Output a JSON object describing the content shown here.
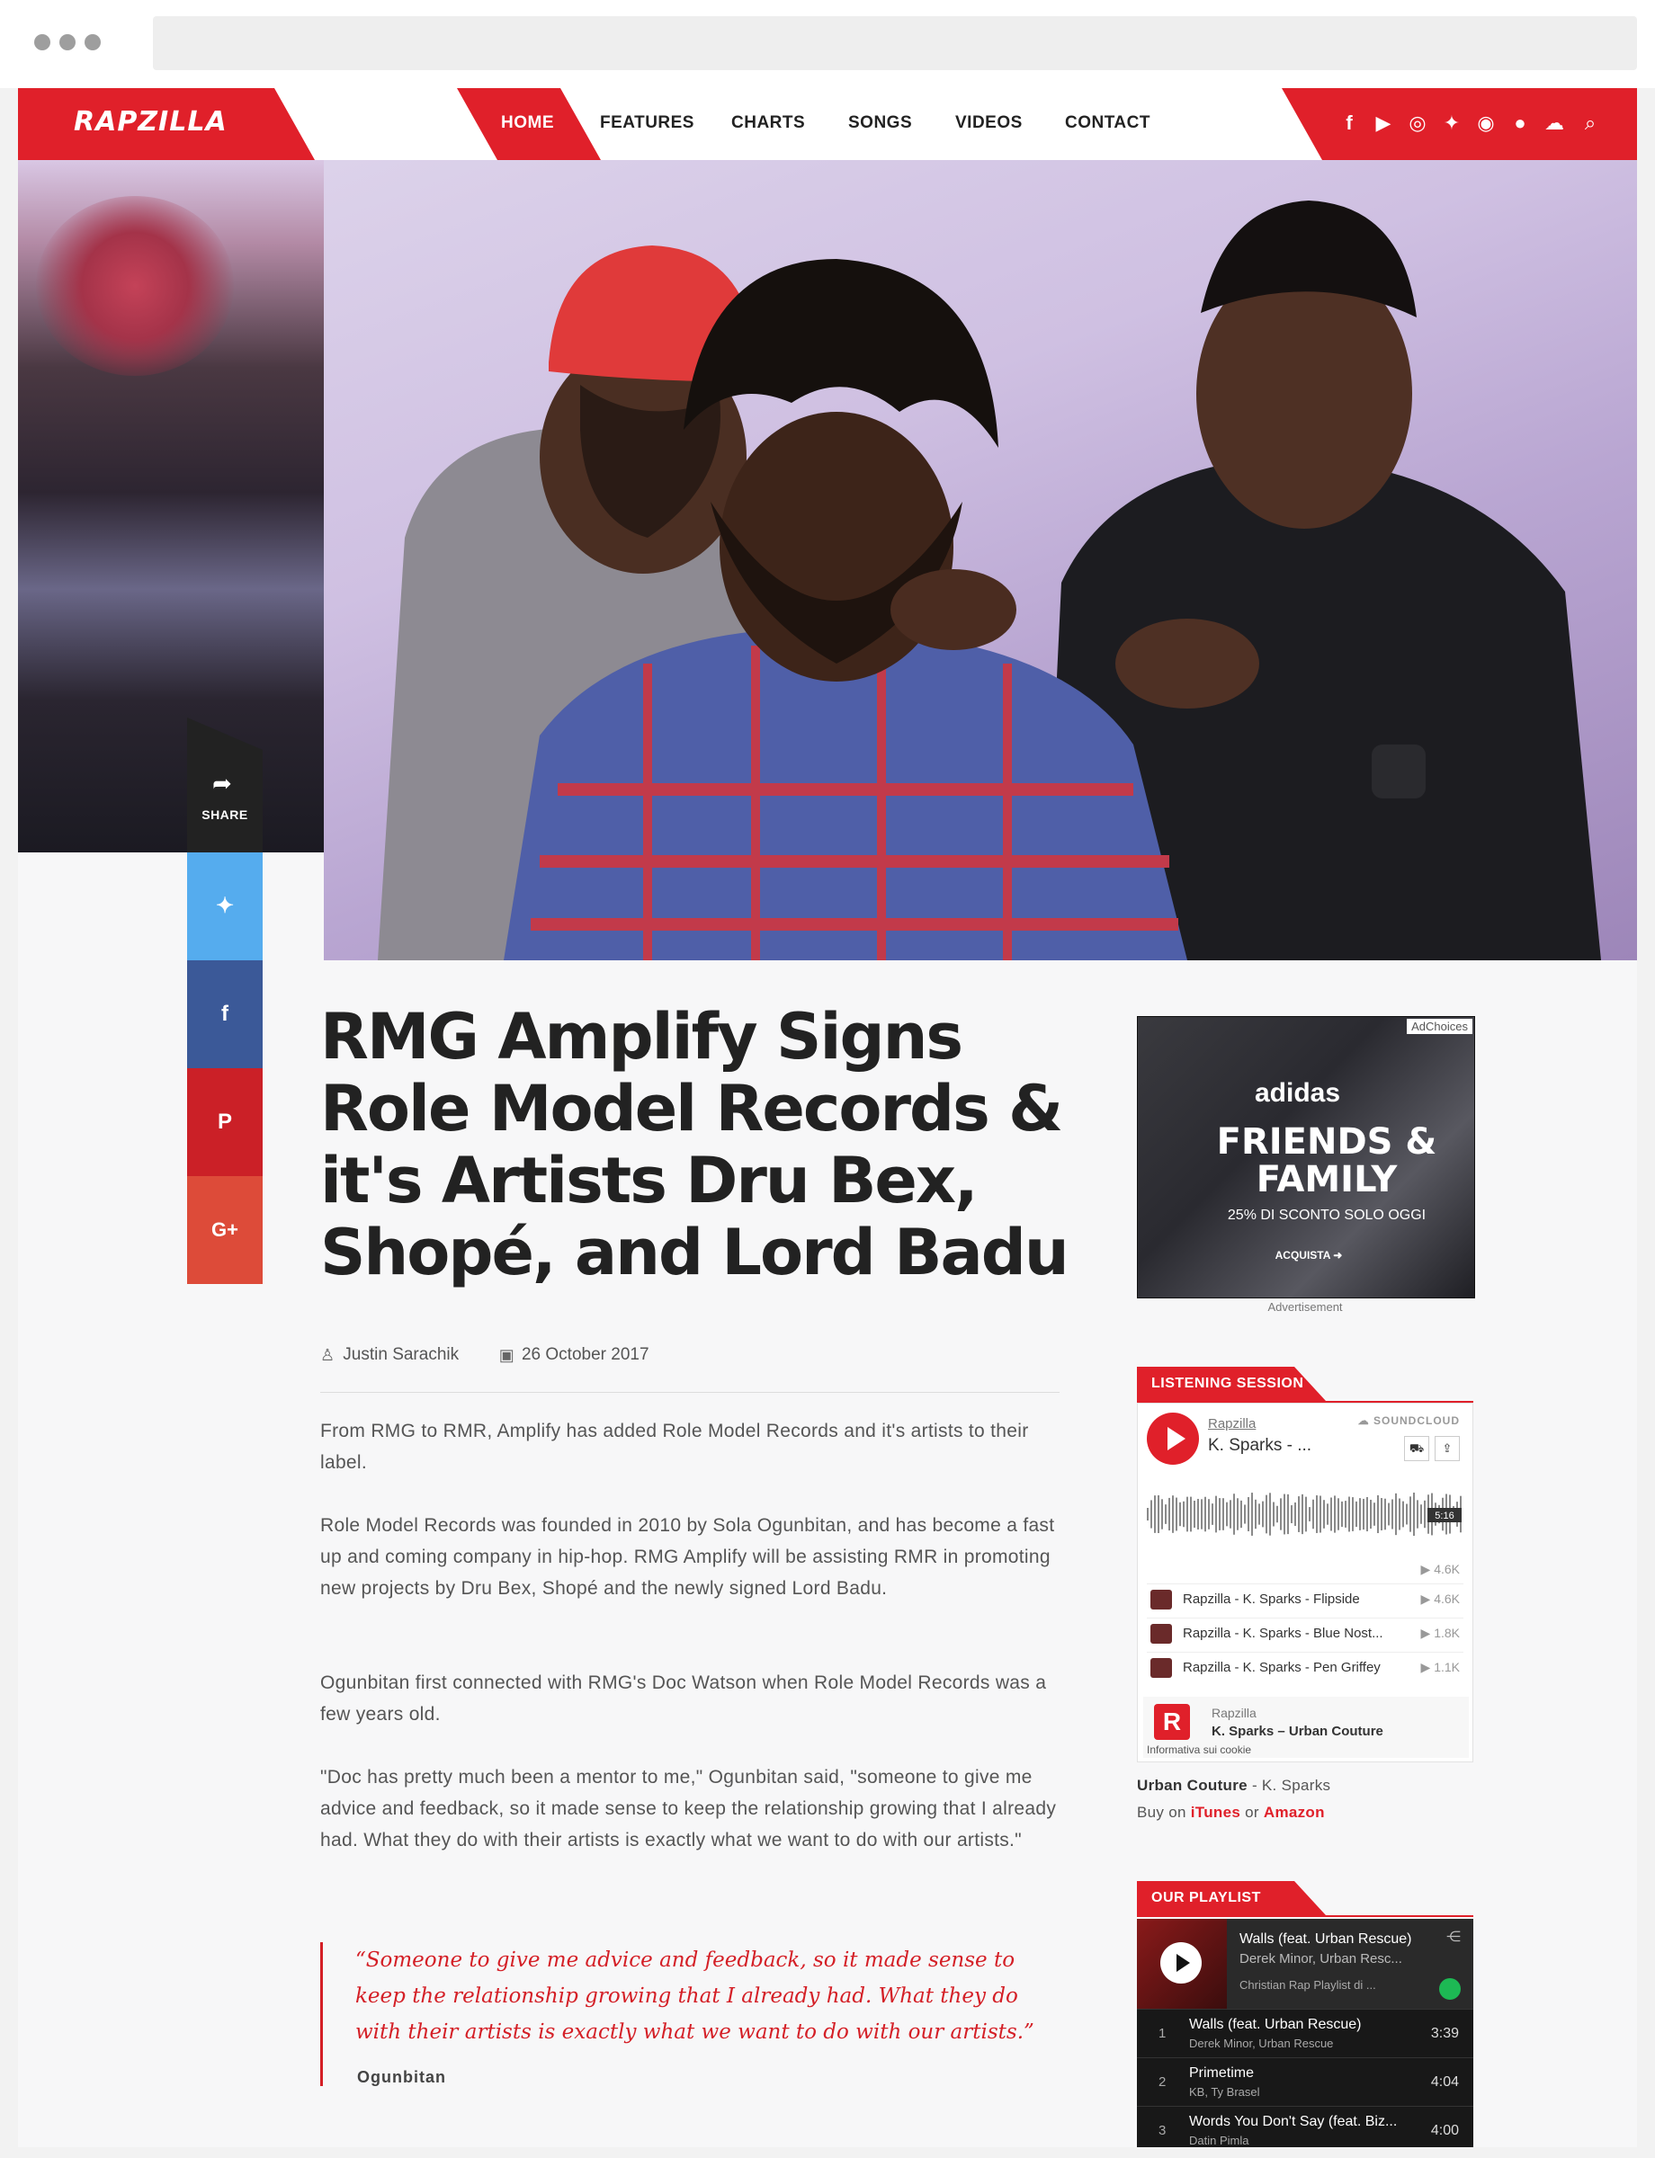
{
  "nav": {
    "logo": "RAPZILLA",
    "items": [
      "HOME",
      "FEATURES",
      "CHARTS",
      "SONGS",
      "VIDEOS",
      "CONTACT"
    ],
    "social_icons": [
      "facebook-icon",
      "youtube-icon",
      "instagram-icon",
      "twitter-icon",
      "spotify-icon",
      "apple-icon",
      "soundcloud-icon",
      "search-icon"
    ]
  },
  "share": {
    "label": "SHARE",
    "buttons": [
      "twitter",
      "facebook",
      "pinterest",
      "google-plus"
    ],
    "google_label": "G+"
  },
  "article": {
    "title": "RMG Amplify Signs Role Model Records & it's Artists Dru Bex, Shopé, and Lord Badu",
    "author": "Justin Sarachik",
    "date": "26 October 2017",
    "paragraphs": [
      "From RMG to RMR, Amplify has added Role Model Records and it's artists to their label.",
      "Role Model Records was founded in 2010 by Sola Ogunbitan, and has become a fast up and coming company in hip-hop. RMG Amplify will be assisting RMR in promoting new projects by Dru Bex, Shopé and the newly signed Lord Badu.",
      "Ogunbitan first connected with RMG's Doc Watson when Role Model Records was a few years old.",
      "\"Doc has pretty much been a mentor to me,\" Ogunbitan said, \"someone to give me advice and feedback, so it made sense to keep the relationship growing that I already had. What they do with their artists is exactly what we want to do with our artists.\""
    ],
    "quote": "“Someone to give me advice and feedback, so it made sense to keep the relationship growing that I already had. What they do with their artists is exactly what we want to do with our artists.”",
    "quote_author": "Ogunbitan"
  },
  "ad": {
    "choices": "AdChoices",
    "brand": "adidas",
    "headline": "FRIENDS & FAMILY",
    "sub": "25% DI SCONTO SOLO OGGI",
    "cta": "ACQUISTA ➜",
    "label": "Advertisement"
  },
  "listening": {
    "heading": "LISTENING SESSION",
    "user": "Rapzilla",
    "track": "K. Sparks - ...",
    "brand": "SOUNDCLOUD",
    "duration": "5:16",
    "total_plays": "▶ 4.6K",
    "tracks": [
      {
        "name": "Rapzilla - K. Sparks - Flipside",
        "plays": "▶ 4.6K"
      },
      {
        "name": "Rapzilla - K. Sparks - Blue Nost...",
        "plays": "▶ 1.8K"
      },
      {
        "name": "Rapzilla - K. Sparks - Pen Griffey",
        "plays": "▶ 1.1K"
      }
    ],
    "footer_user": "Rapzilla",
    "footer_track": "K. Sparks – Urban Couture",
    "cookie": "Informativa sui cookie",
    "caption_album": "Urban Couture",
    "caption_artist": "- K. Sparks",
    "buy_prefix": "Buy on",
    "itunes": "iTunes",
    "or": "or",
    "amazon": "Amazon"
  },
  "playlist": {
    "heading": "OUR PLAYLIST",
    "now_title": "Walls (feat. Urban Rescue)",
    "now_artist": "Derek Minor, Urban Resc...",
    "playlist_name": "Christian Rap Playlist di ...",
    "tracks": [
      {
        "n": "1",
        "title": "Walls (feat. Urban Rescue)",
        "artist": "Derek Minor, Urban Rescue",
        "dur": "3:39"
      },
      {
        "n": "2",
        "title": "Primetime",
        "artist": "KB, Ty Brasel",
        "dur": "4:04"
      },
      {
        "n": "3",
        "title": "Words You Don't Say (feat. Biz...",
        "artist": "Datin Pimla",
        "dur": "4:00"
      }
    ]
  },
  "colors": {
    "brand_red": "#e0202a",
    "twitter": "#55acee",
    "facebook": "#3b5998",
    "pinterest": "#cb2027",
    "google": "#dd4b39"
  }
}
